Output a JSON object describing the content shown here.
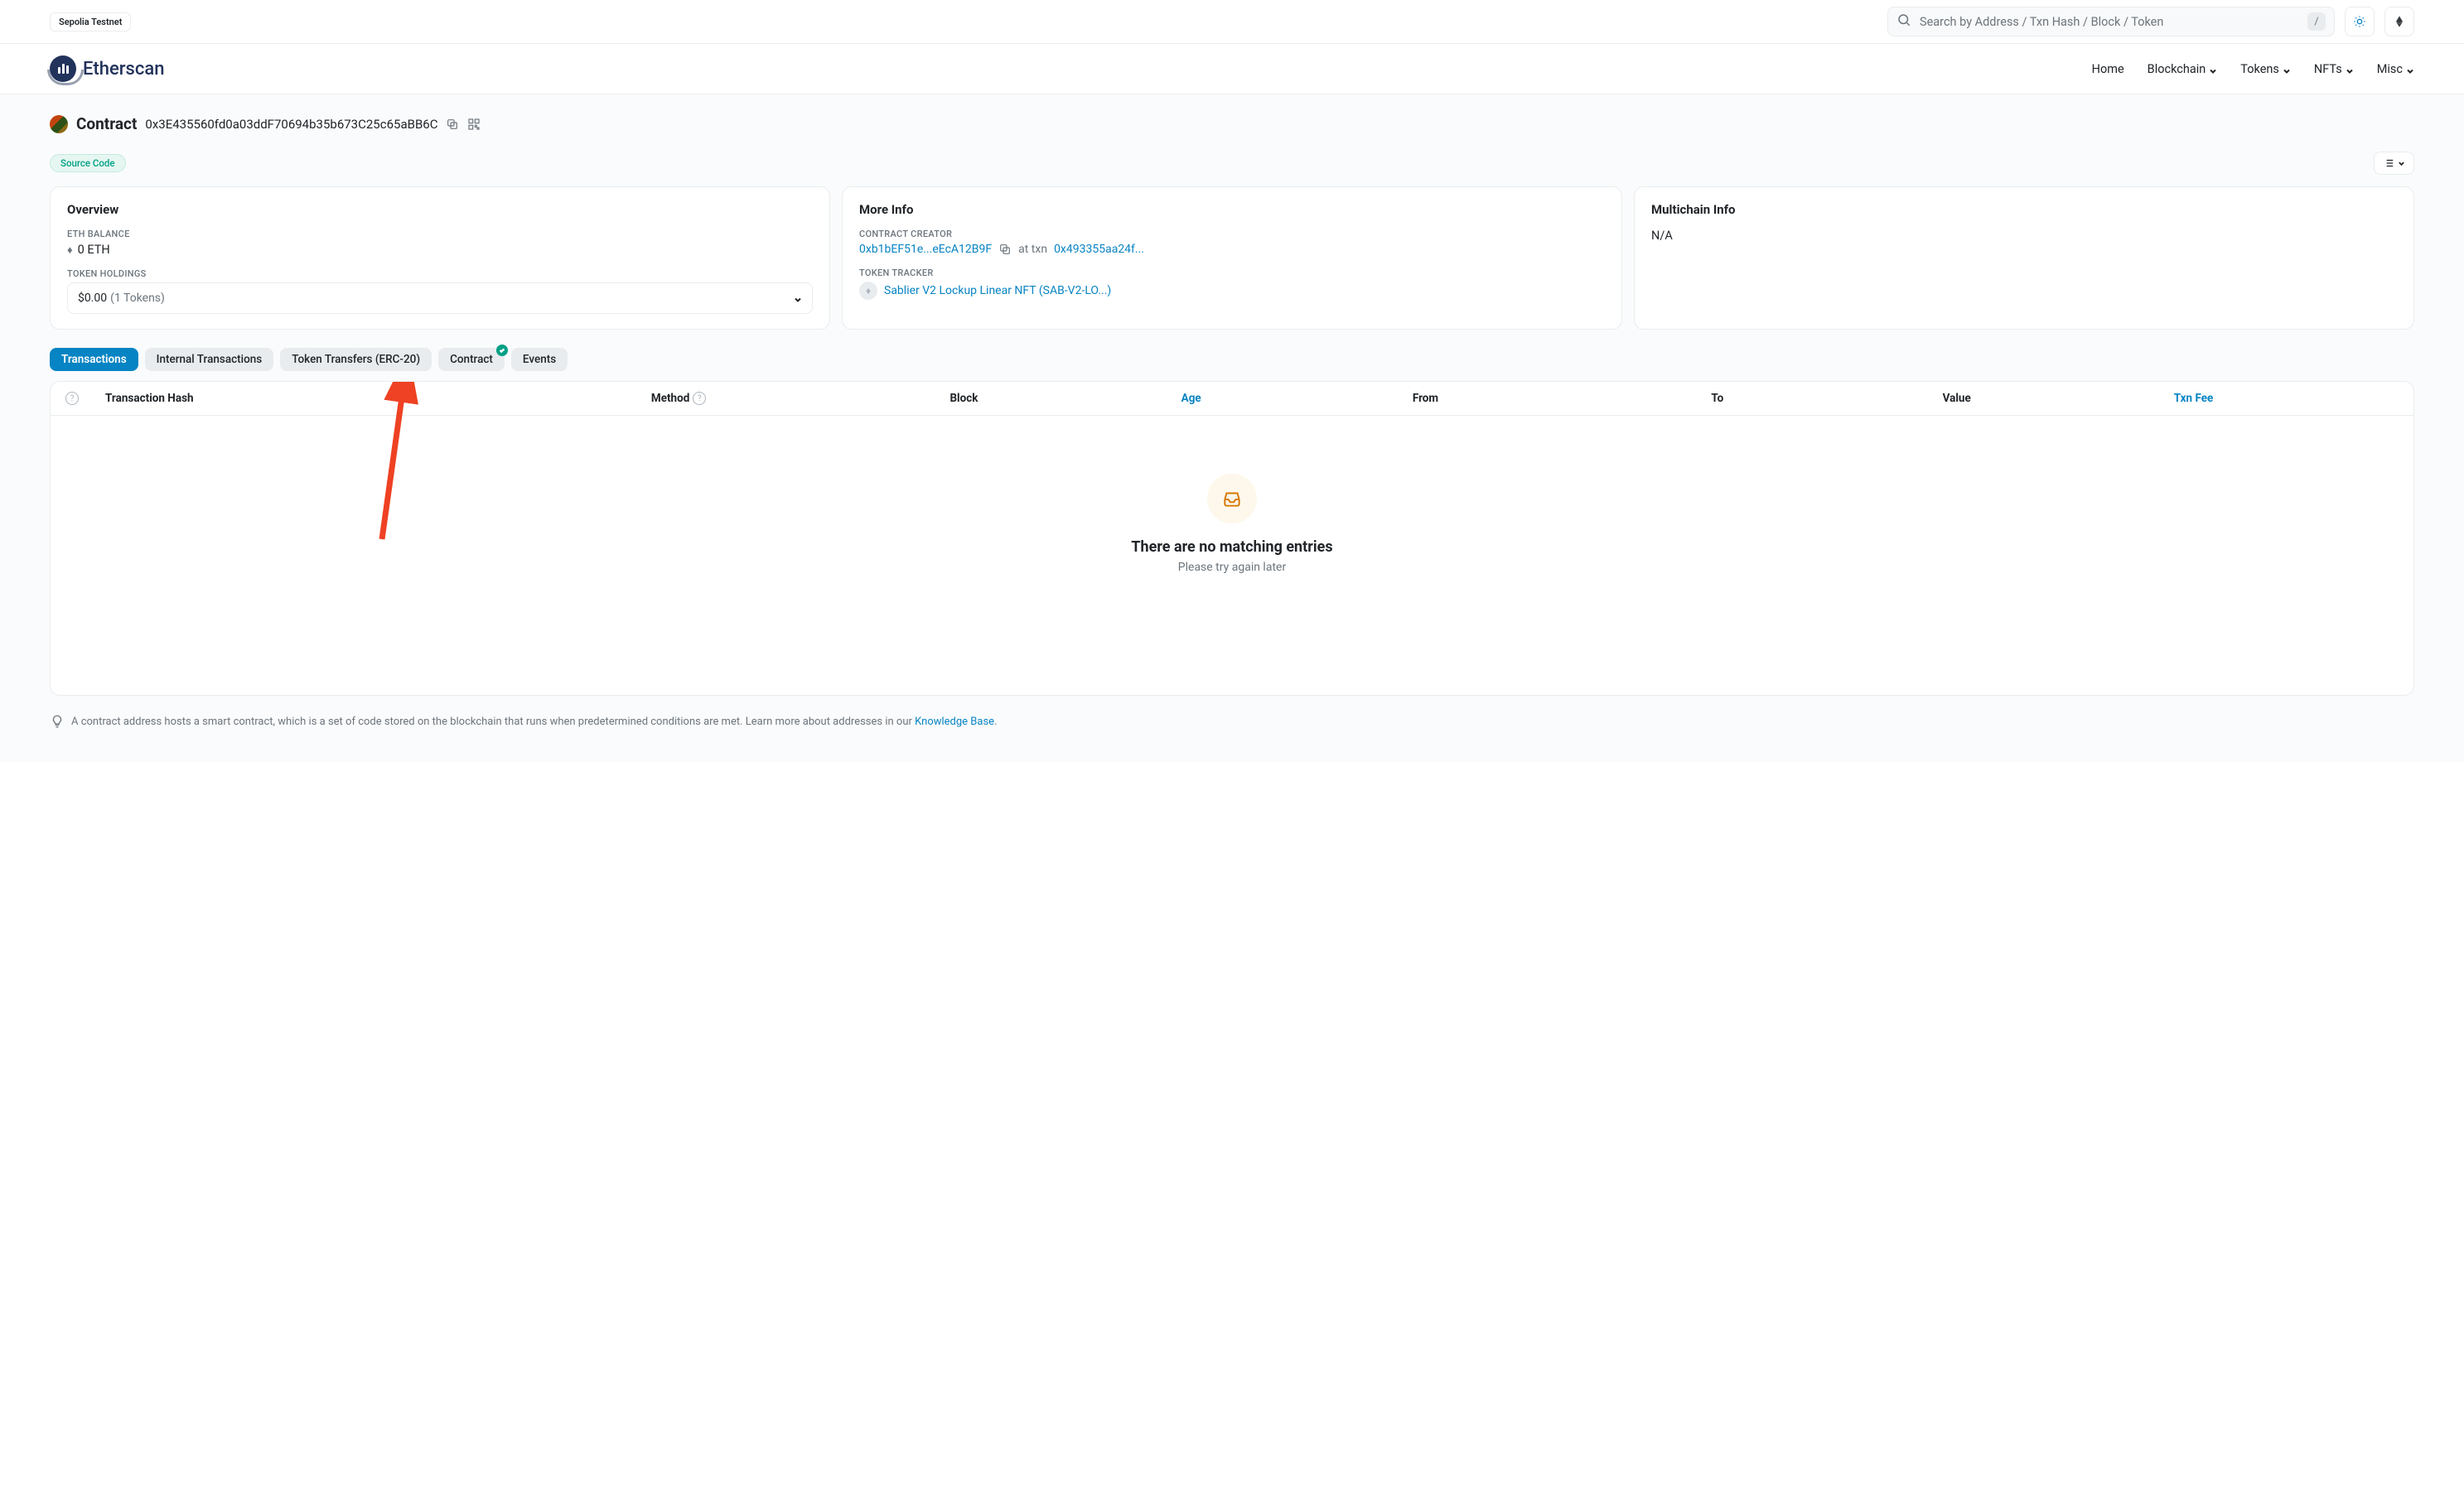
{
  "topbar": {
    "network": "Sepolia Testnet",
    "search_placeholder": "Search by Address / Txn Hash / Block / Token",
    "kbd_hint": "/"
  },
  "nav": {
    "brand": "Etherscan",
    "items": [
      "Home",
      "Blockchain",
      "Tokens",
      "NFTs",
      "Misc"
    ]
  },
  "title": {
    "label": "Contract",
    "address": "0x3E435560fd0a03ddF70694b35b673C25c65aBB6C",
    "badge": "Source Code"
  },
  "overview": {
    "heading": "Overview",
    "balance_label": "ETH BALANCE",
    "balance_value": "0 ETH",
    "holdings_label": "TOKEN HOLDINGS",
    "holdings_value": "$0.00",
    "holdings_count": "(1 Tokens)"
  },
  "moreinfo": {
    "heading": "More Info",
    "creator_label": "CONTRACT CREATOR",
    "creator_addr": "0xb1bEF51e...eEcA12B9F",
    "at_txn": "at txn",
    "creator_txn": "0x493355aa24f...",
    "tracker_label": "TOKEN TRACKER",
    "tracker_name": "Sablier V2 Lockup Linear NFT (SAB-V2-LO...)"
  },
  "multichain": {
    "heading": "Multichain Info",
    "value": "N/A"
  },
  "tabs": [
    "Transactions",
    "Internal Transactions",
    "Token Transfers (ERC-20)",
    "Contract",
    "Events"
  ],
  "table": {
    "cols": [
      "Transaction Hash",
      "Method",
      "Block",
      "Age",
      "From",
      "To",
      "Value",
      "Txn Fee"
    ],
    "empty_title": "There are no matching entries",
    "empty_sub": "Please try again later"
  },
  "tip": {
    "text_a": "A contract address hosts a smart contract, which is a set of code stored on the blockchain that runs when predetermined conditions are met. Learn more about addresses in our ",
    "link": "Knowledge Base",
    "text_b": "."
  }
}
